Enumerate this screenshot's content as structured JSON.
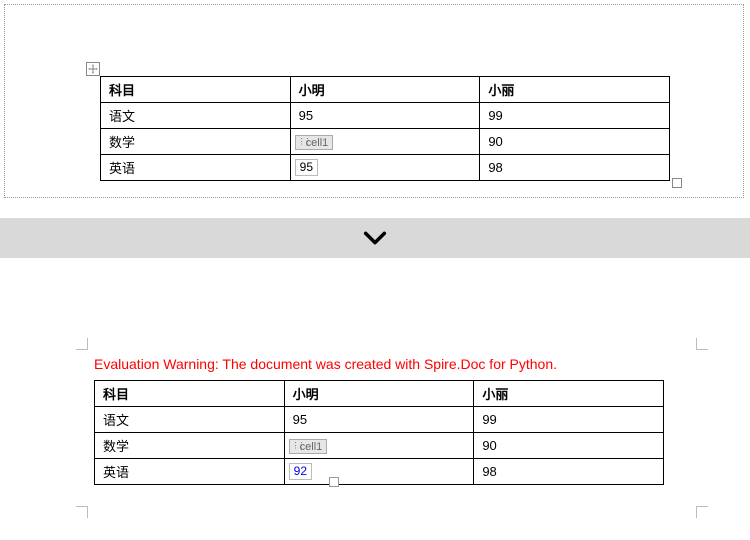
{
  "table1": {
    "headers": [
      "科目",
      "小明",
      "小丽"
    ],
    "rows": [
      [
        "语文",
        "95",
        "99"
      ],
      [
        "数学",
        "",
        "90"
      ],
      [
        "英语",
        "95",
        "98"
      ]
    ],
    "cell_tag_label": "cell1"
  },
  "separator": {
    "icon": "chevron-down"
  },
  "warning": "Evaluation Warning: The document was created with Spire.Doc for Python.",
  "table2": {
    "headers": [
      "科目",
      "小明",
      "小丽"
    ],
    "rows": [
      [
        "语文",
        "95",
        "99"
      ],
      [
        "数学",
        "",
        "90"
      ],
      [
        "英语",
        "92",
        "98"
      ]
    ],
    "cell_tag_label": "cell1",
    "changed_value": "92"
  }
}
